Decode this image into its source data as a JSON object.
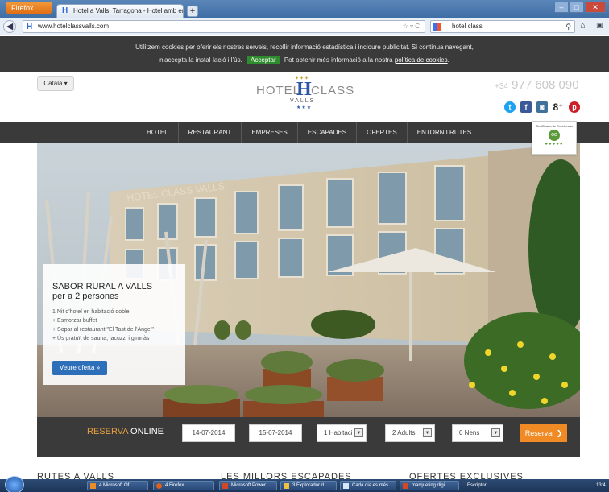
{
  "browser": {
    "menu_button": "Firefox",
    "tab_title": "Hotel a Valls, Tarragona - Hotel amb enc...",
    "new_tab": "+",
    "url": "www.hotelclassvalls.com",
    "search_query": "hotel class"
  },
  "cookie_bar": {
    "line1": "Utilitzem cookies per oferir els nostres serveis, recollir informació estadística i incloure publicitat. Si continua navegant,",
    "line2_pre": "n'accepta la instal·lació i l'ús.",
    "accept_label": "Acceptar",
    "line2_post": "Pot obtenir més informació a la nostra",
    "policy_link": "política de cookies"
  },
  "header": {
    "language": "Català ▾",
    "logo_word1": "HOTEL",
    "logo_h": "H",
    "logo_word2": "CLASS",
    "logo_sub": "VALLS",
    "phone_prefix": "+34",
    "phone_number": "977 608 090",
    "tripadvisor_label": "Certificado de Excelencia"
  },
  "menu": {
    "items": [
      "HOTEL",
      "RESTAURANT",
      "EMPRESES",
      "ESCAPADES",
      "OFERTES",
      "ENTORN I RUTES"
    ]
  },
  "hero": {
    "building_sign": "HOTEL CLASS VALLS"
  },
  "promo": {
    "title_line1": "SABOR RURAL A VALLS",
    "title_line2": "per a 2 persones",
    "items": [
      "1 Nit d'hotel en habitació doble",
      "+ Esmorzar buffet",
      "+ Sopar al restaurant \"El Tast de l'Àngel\"",
      "+ Ús gratuït de sauna, jacuzzi i gimnàs"
    ],
    "cta": "Veure oferta »"
  },
  "booking": {
    "label_accent": "RESERVA",
    "label_rest": "ONLINE",
    "checkin": "14-07-2014",
    "checkout": "15-07-2014",
    "rooms": "1 Habitaci",
    "adults": "2 Adults",
    "children": "0 Nens",
    "submit": "Reservar ❯"
  },
  "sections": [
    "RUTES A VALLS",
    "LES MILLORS ESCAPADES",
    "OFERTES EXCLUSIVES"
  ],
  "taskbar": {
    "items": [
      "4 Microsoft Of...",
      "4 Firefox",
      "Microsoft Power...",
      "3 Explorador d...",
      "Cada dia es més...",
      "marqueting digi..."
    ],
    "tray_text": "Escriptori",
    "clock": "13:4"
  }
}
